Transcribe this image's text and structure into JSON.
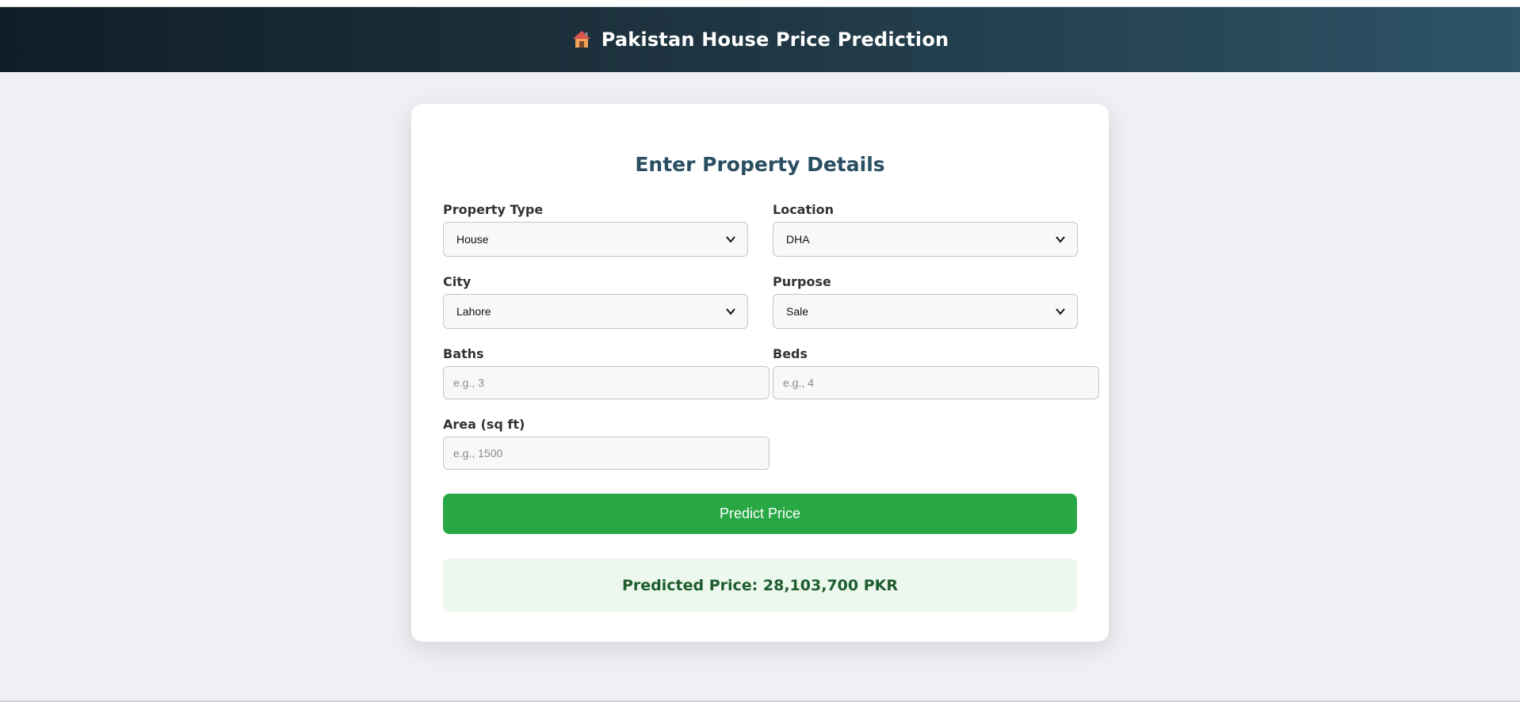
{
  "header": {
    "title": "Pakistan House Price Prediction",
    "icon": "house-emoji-icon"
  },
  "form": {
    "title": "Enter Property Details",
    "property_type": {
      "label": "Property Type",
      "value": "House"
    },
    "location": {
      "label": "Location",
      "value": "DHA"
    },
    "city": {
      "label": "City",
      "value": "Lahore"
    },
    "purpose": {
      "label": "Purpose",
      "value": "Sale"
    },
    "baths": {
      "label": "Baths",
      "placeholder": "e.g., 3"
    },
    "beds": {
      "label": "Beds",
      "placeholder": "e.g., 4"
    },
    "area": {
      "label": "Area (sq ft)",
      "placeholder": "e.g., 1500"
    },
    "submit_label": "Predict Price"
  },
  "result": {
    "text": "Predicted Price: 28,103,700 PKR"
  },
  "colors": {
    "accent": "#28a745",
    "title": "#2a4f62",
    "result_bg": "#ecf7ee",
    "result_text": "#1e5c2e"
  }
}
